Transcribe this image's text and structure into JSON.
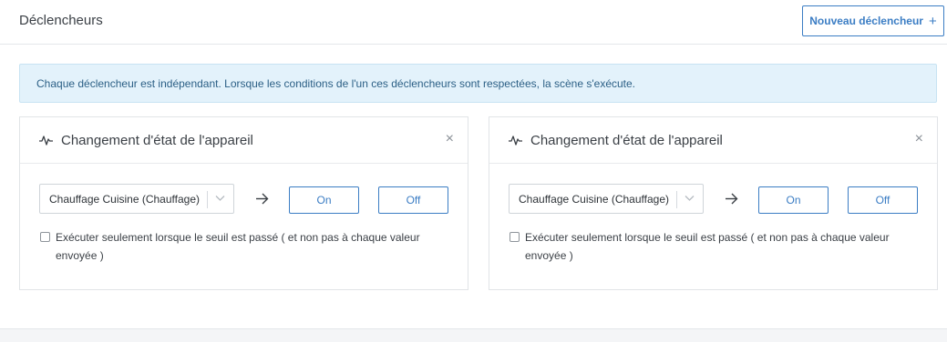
{
  "header": {
    "title": "Déclencheurs",
    "new_trigger_label": "Nouveau déclencheur",
    "new_trigger_icon": "+"
  },
  "info": {
    "message": "Chaque déclencheur est indépendant. Lorsque les conditions de l'un ces déclencheurs sont respectées, la scène s'exécute."
  },
  "triggers": [
    {
      "title": "Changement d'état de l'appareil",
      "icon": "pulse-icon",
      "close_label": "×",
      "device": "Chauffage Cuisine (Chauffage)",
      "on_label": "On",
      "off_label": "Off",
      "threshold_checked": false,
      "threshold_label": "Exécuter seulement lorsque le seuil est passé ( et non pas à chaque valeur envoyée )"
    },
    {
      "title": "Changement d'état de l'appareil",
      "icon": "pulse-icon",
      "close_label": "×",
      "device": "Chauffage Cuisine (Chauffage)",
      "on_label": "On",
      "off_label": "Off",
      "threshold_checked": false,
      "threshold_label": "Exécuter seulement lorsque le seuil est passé ( et non pas à chaque valeur envoyée )"
    }
  ],
  "colors": {
    "accent": "#3b7dc4",
    "info_bg": "#e3f2fb",
    "info_text": "#2b5f85"
  }
}
